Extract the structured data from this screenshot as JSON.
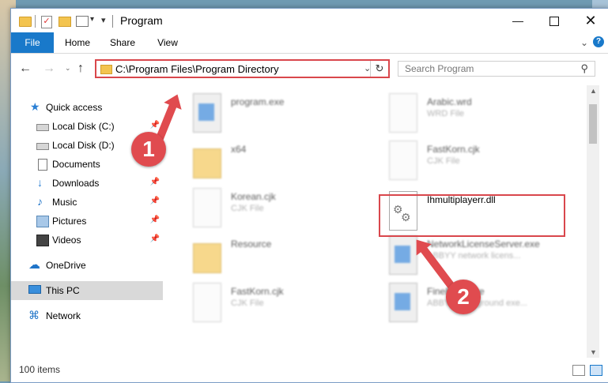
{
  "window": {
    "title": "Program",
    "controls": {
      "minimize": "—",
      "maximize": "",
      "close": "✕"
    }
  },
  "ribbon": {
    "tabs": [
      {
        "label": "File",
        "active": true
      },
      {
        "label": "Home"
      },
      {
        "label": "Share"
      },
      {
        "label": "View"
      }
    ],
    "help": "?"
  },
  "address_bar": {
    "path": "C:\\Program Files\\Program Directory"
  },
  "search": {
    "placeholder": "Search Program"
  },
  "sidebar": {
    "items": [
      {
        "label": "Quick access",
        "icon": "star-icon"
      },
      {
        "label": "Local Disk (C:)",
        "icon": "disk-icon",
        "pinned": true
      },
      {
        "label": "Local Disk (D:)",
        "icon": "disk-icon",
        "pinned": true
      },
      {
        "label": "Documents",
        "icon": "documents-icon",
        "pinned": true
      },
      {
        "label": "Downloads",
        "icon": "download-icon",
        "pinned": true
      },
      {
        "label": "Music",
        "icon": "music-icon",
        "pinned": true
      },
      {
        "label": "Pictures",
        "icon": "pictures-icon",
        "pinned": true
      },
      {
        "label": "Videos",
        "icon": "videos-icon",
        "pinned": true
      },
      {
        "label": "OneDrive",
        "icon": "cloud-icon"
      },
      {
        "label": "This PC",
        "icon": "computer-icon",
        "selected": true
      },
      {
        "label": "Network",
        "icon": "network-icon"
      }
    ]
  },
  "files": [
    {
      "name": "program.exe",
      "type": "",
      "icon": "exe-icon"
    },
    {
      "name": "Arabic.wrd",
      "type": "WRD File",
      "icon": "file-icon"
    },
    {
      "name": "x64",
      "type": "",
      "icon": "folder-icon"
    },
    {
      "name": "FastKorn.cjk",
      "type": "CJK File",
      "icon": "file-icon"
    },
    {
      "name": "Korean.cjk",
      "type": "CJK File",
      "icon": "file-icon"
    },
    {
      "name": "Ihmultiplayerr.dll",
      "type": "",
      "icon": "dll-icon",
      "highlighted": true
    },
    {
      "name": "Resource",
      "type": "",
      "icon": "folder-icon"
    },
    {
      "name": "NetworkLicenseServer.exe",
      "type": "ABBYY network licens...",
      "icon": "exe-icon"
    },
    {
      "name": "FastKorn.cjk",
      "type": "CJK File",
      "icon": "file-icon"
    },
    {
      "name": "FineExec.exe",
      "type": "ABBYY background exe...",
      "icon": "exe-icon"
    }
  ],
  "status": {
    "items_count": "100 items"
  },
  "callouts": [
    {
      "number": "1"
    },
    {
      "number": "2"
    }
  ],
  "colors": {
    "accent": "#1979ca",
    "highlight": "#d9474c",
    "callout": "#e04b4f"
  }
}
